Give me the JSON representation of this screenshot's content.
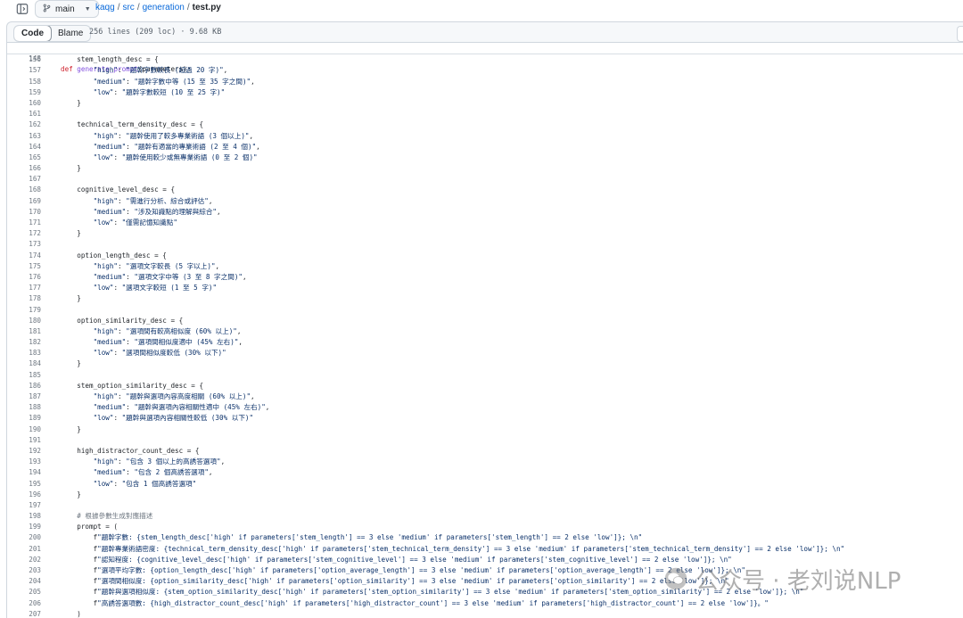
{
  "header": {
    "branch_label": "main",
    "breadcrumb": {
      "repo": "kaqg",
      "dir1": "src",
      "dir2": "generation",
      "file": "test.py"
    }
  },
  "file_header": {
    "tabs": [
      {
        "label": "Code",
        "active": true
      },
      {
        "label": "Blame",
        "active": false
      }
    ],
    "meta": "256 lines (209 loc) · 9.68 KB"
  },
  "code": {
    "sticky_line": {
      "num": "148",
      "text": "def generate_prompt(parameters):"
    },
    "lines": [
      {
        "num": "156",
        "text": "    stem_length_desc = {"
      },
      {
        "num": "157",
        "text": "        \"high\": \"題幹字數較長 (超過 20 字)\","
      },
      {
        "num": "158",
        "text": "        \"medium\": \"題幹字數中等 (15 至 35 字之間)\","
      },
      {
        "num": "159",
        "text": "        \"low\": \"題幹字數較短 (10 至 25 字)\""
      },
      {
        "num": "160",
        "text": "    }"
      },
      {
        "num": "161",
        "text": ""
      },
      {
        "num": "162",
        "text": "    technical_term_density_desc = {"
      },
      {
        "num": "163",
        "text": "        \"high\": \"題幹使用了較多專業術語 (3 個以上)\","
      },
      {
        "num": "164",
        "text": "        \"medium\": \"題幹有適當的專業術語 (2 至 4 個)\","
      },
      {
        "num": "165",
        "text": "        \"low\": \"題幹使用較少或無專業術語 (0 至 2 個)\""
      },
      {
        "num": "166",
        "text": "    }"
      },
      {
        "num": "167",
        "text": ""
      },
      {
        "num": "168",
        "text": "    cognitive_level_desc = {"
      },
      {
        "num": "169",
        "text": "        \"high\": \"需進行分析、綜合或評估\","
      },
      {
        "num": "170",
        "text": "        \"medium\": \"涉及知識點的理解與綜合\","
      },
      {
        "num": "171",
        "text": "        \"low\": \"僅需記憶知識點\""
      },
      {
        "num": "172",
        "text": "    }"
      },
      {
        "num": "173",
        "text": ""
      },
      {
        "num": "174",
        "text": "    option_length_desc = {"
      },
      {
        "num": "175",
        "text": "        \"high\": \"選項文字較長 (5 字以上)\","
      },
      {
        "num": "176",
        "text": "        \"medium\": \"選項文字中等 (3 至 8 字之間)\","
      },
      {
        "num": "177",
        "text": "        \"low\": \"選項文字較短 (1 至 5 字)\""
      },
      {
        "num": "178",
        "text": "    }"
      },
      {
        "num": "179",
        "text": ""
      },
      {
        "num": "180",
        "text": "    option_similarity_desc = {"
      },
      {
        "num": "181",
        "text": "        \"high\": \"選項間有較高相似度 (60% 以上)\","
      },
      {
        "num": "182",
        "text": "        \"medium\": \"選項間相似度適中 (45% 左右)\","
      },
      {
        "num": "183",
        "text": "        \"low\": \"選項間相似度較低 (30% 以下)\""
      },
      {
        "num": "184",
        "text": "    }"
      },
      {
        "num": "185",
        "text": ""
      },
      {
        "num": "186",
        "text": "    stem_option_similarity_desc = {"
      },
      {
        "num": "187",
        "text": "        \"high\": \"題幹與選項內容高度相關 (60% 以上)\","
      },
      {
        "num": "188",
        "text": "        \"medium\": \"題幹與選項內容相關性適中 (45% 左右)\","
      },
      {
        "num": "189",
        "text": "        \"low\": \"題幹與選項內容相關性較低 (30% 以下)\""
      },
      {
        "num": "190",
        "text": "    }"
      },
      {
        "num": "191",
        "text": ""
      },
      {
        "num": "192",
        "text": "    high_distractor_count_desc = {"
      },
      {
        "num": "193",
        "text": "        \"high\": \"包含 3 個以上的高誘答選項\","
      },
      {
        "num": "194",
        "text": "        \"medium\": \"包含 2 個高誘答選項\","
      },
      {
        "num": "195",
        "text": "        \"low\": \"包含 1 個高誘答選項\""
      },
      {
        "num": "196",
        "text": "    }"
      },
      {
        "num": "197",
        "text": ""
      },
      {
        "num": "198",
        "text": "    # 根據參數生成對應描述"
      },
      {
        "num": "199",
        "text": "    prompt = ("
      },
      {
        "num": "200",
        "text": "        f\"題幹字數: {stem_length_desc['high' if parameters['stem_length'] == 3 else 'medium' if parameters['stem_length'] == 2 else 'low']}; \\n\""
      },
      {
        "num": "201",
        "text": "        f\"題幹專業術語密度: {technical_term_density_desc['high' if parameters['stem_technical_term_density'] == 3 else 'medium' if parameters['stem_technical_term_density'] == 2 else 'low']}; \\n\""
      },
      {
        "num": "202",
        "text": "        f\"認知程度: {cognitive_level_desc['high' if parameters['stem_cognitive_level'] == 3 else 'medium' if parameters['stem_cognitive_level'] == 2 else 'low']}; \\n\""
      },
      {
        "num": "203",
        "text": "        f\"選項平均字數: {option_length_desc['high' if parameters['option_average_length'] == 3 else 'medium' if parameters['option_average_length'] == 2 else 'low']}; \\n\""
      },
      {
        "num": "204",
        "text": "        f\"選項間相似度: {option_similarity_desc['high' if parameters['option_similarity'] == 3 else 'medium' if parameters['option_similarity'] == 2 else 'low']}; \\n\""
      },
      {
        "num": "205",
        "text": "        f\"題幹與選項相似度: {stem_option_similarity_desc['high' if parameters['stem_option_similarity'] == 3 else 'medium' if parameters['stem_option_similarity'] == 2 else 'low']}; \\n\""
      },
      {
        "num": "206",
        "text": "        f\"高誘答選項數: {high_distractor_count_desc['high' if parameters['high_distractor_count'] == 3 else 'medium' if parameters['high_distractor_count'] == 2 else 'low']}。\""
      },
      {
        "num": "207",
        "text": "    )"
      }
    ]
  },
  "watermark": {
    "text": "公众号 · 老刘说NLP"
  },
  "colors": {
    "link": "#0969da",
    "keyword": "#cf222e",
    "function": "#8250df",
    "string": "#0a3069",
    "comment": "#6e7781"
  }
}
